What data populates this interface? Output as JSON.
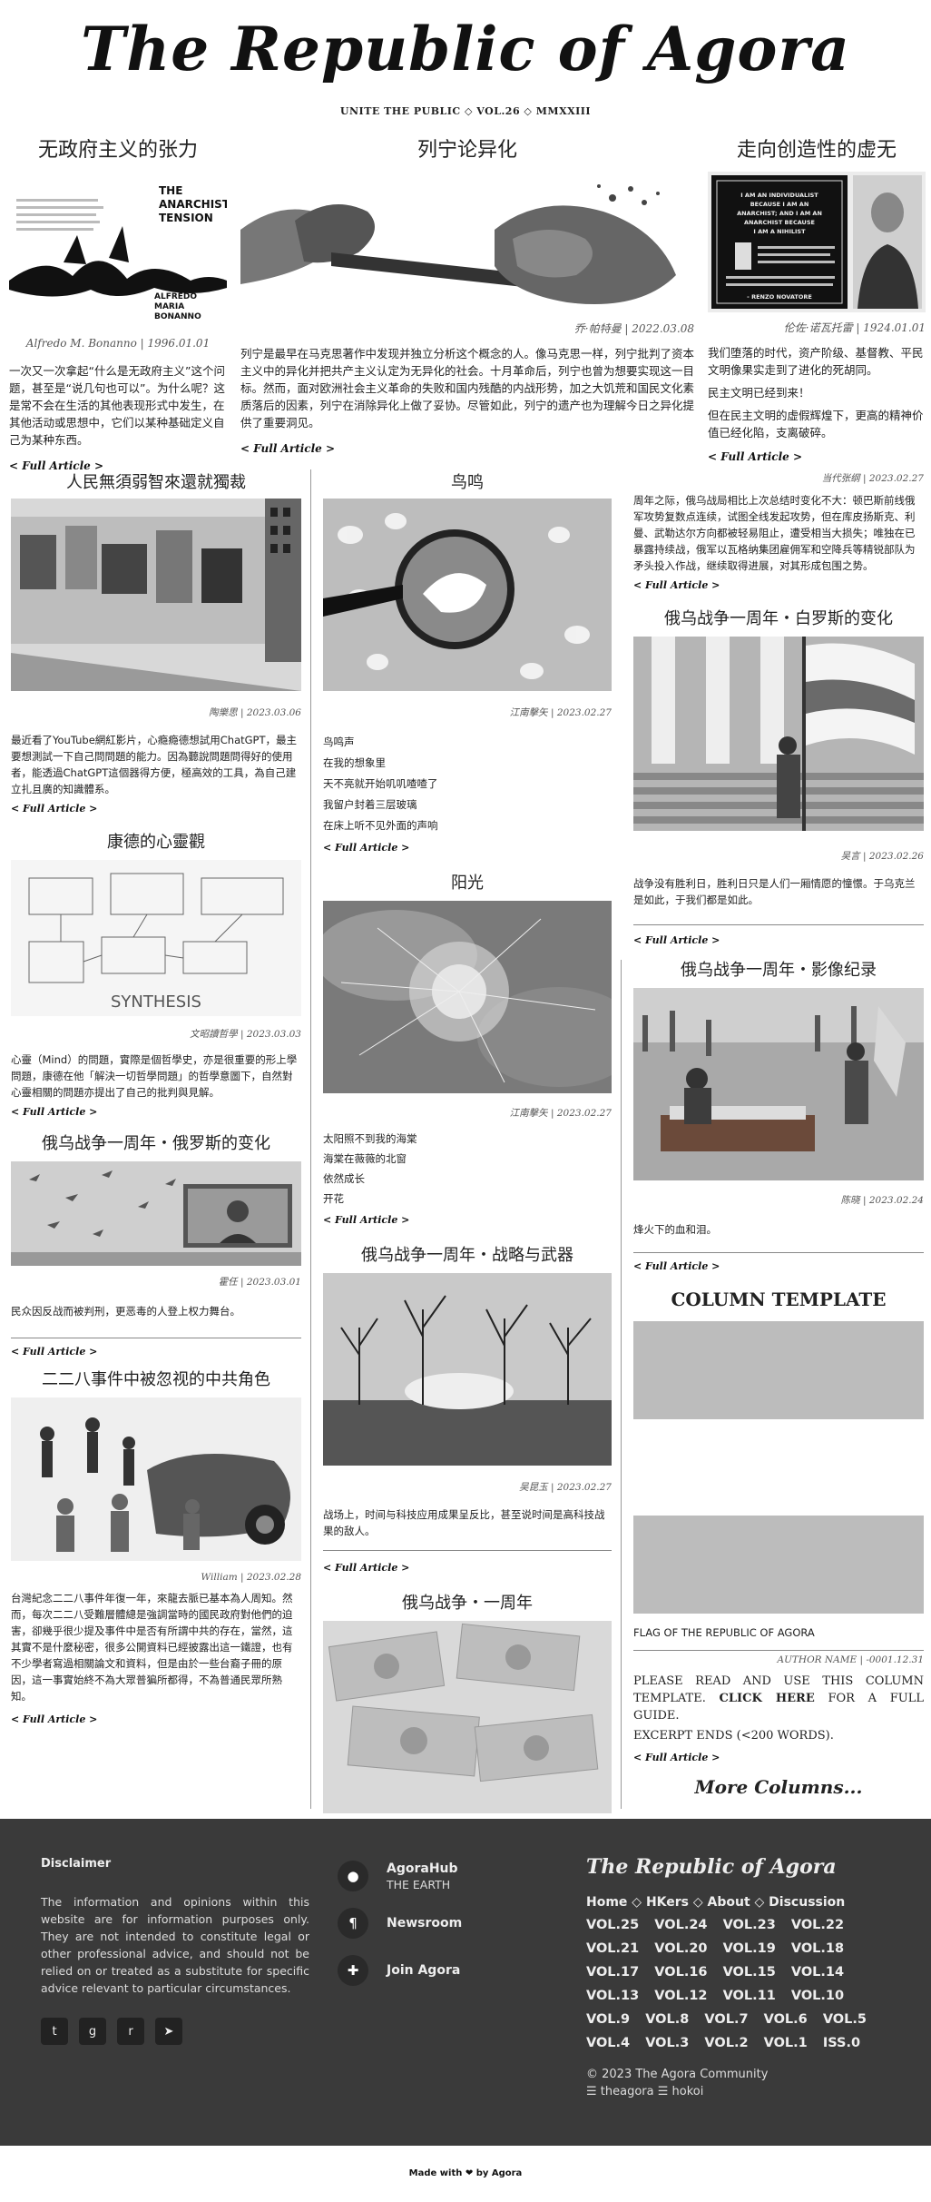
{
  "masthead": {
    "title": "The Republic of Agora",
    "tagline": "UNITE THE PUBLIC ◇ VOL.26 ◇ MMXXIII"
  },
  "top_articles": [
    {
      "title": "无政府主义的张力",
      "image_caption": "THE ANARCHIST TENSION",
      "image_author": "ALFREDO MARIA BONANNO",
      "meta": "Alfredo M. Bonanno | 1996.01.01",
      "body": "一次又一次拿起“什么是无政府主义”这个问题，甚至是“说几句也可以”。为什么呢？这是常不会在生活的其他表现形式中发生，在其他活动或思想中，它们以某种基础定义自己为某种东西。",
      "link": "< Full Article >"
    },
    {
      "title": "列宁论异化",
      "meta": "乔·帕特曼 | 2022.03.08",
      "body": "列宁是最早在马克思著作中发现并独立分析这个概念的人。像马克思一样，列宁批判了资本主义中的异化并把共产主义认定为无异化的社会。十月革命后，列宁也曾为想要实现这一目标。然而，面对欧洲社会主义革命的失败和国内残酷的内战形势，加之大饥荒和国民文化素质落后的因素，列宁在消除异化上做了妥协。尽管如此，列宁的遗产也为理解今日之异化提供了重要洞见。",
      "link": "< Full Article >"
    },
    {
      "title": "走向创造性的虚无",
      "image_caption": "I AM AN INDIVIDUALIST BECAUSE I AM AN ANARCHIST; AND I AM AN ANARCHIST BECAUSE I AM A NIHILIST",
      "image_author": "- RENZO NOVATORE",
      "meta": "伦佐·诺瓦托雷 | 1924.01.01",
      "body1": "我们堕落的时代，资产阶级、基督教、平民文明像果实走到了进化的死胡同。",
      "body2": "民主文明已经到来！",
      "body3": "但在民主文明的虚假辉煌下，更高的精神价值已经化陷，支离破碎。",
      "link": "< Full Article >"
    }
  ],
  "col1": [
    {
      "title": "人民無須弱智來還就獨裁",
      "meta": "陶樂思 | 2023.03.06",
      "body": "最近看了YouTube網紅影片，心瘾瘾德想試用ChatGPT，最主要想測試一下自己問問題的能力。因為聽說問題問得好的使用者，能透過ChatGPT這個器得方便，極高效的工具，為自己建立扎且廣的知識體系。",
      "link": "< Full Article >"
    },
    {
      "title": "康德的心靈觀",
      "image_label": "SYNTHESIS",
      "meta": "文昭讀哲學 | 2023.03.03",
      "body": "心靈（Mind）的問題，實際是個哲學史，亦是很重要的形上學問題，康德在他「解決一切哲學問題」的哲學意圖下，自然對心靈相關的問題亦提出了自己的批判與見解。",
      "link": "< Full Article >"
    },
    {
      "title": "俄乌战争一周年・俄罗斯的变化",
      "meta": "霍任 | 2023.03.01",
      "body": "民众因反战而被判刑，更恶毒的人登上权力舞台。",
      "link": "< Full Article >"
    },
    {
      "title": "二二八事件中被忽视的中共角色",
      "meta": "William | 2023.02.28",
      "body": "台灣紀念二二八事件年復一年，來龍去脈已基本為人周知。然而，每次二二八受難層體總是強調當時的國民政府對他們的迫害，卻幾乎很少提及事件中是否有所謂中共的存在，當然，這其實不是什麼秘密，很多公開資料已經披露出這一鐵證，也有不少學者寫過相關論文和資料，但是由於一些台裔子冊的原因，這一事實始終不為大眾普猵所都得，不為普通民眾所熟知。",
      "link": "< Full Article >"
    }
  ],
  "col2": [
    {
      "title": "鸟鸣",
      "meta": "江南擊矢 | 2023.02.27",
      "lines": [
        "鸟鸣声",
        "在我的想象里",
        "天不亮就开始叽叽喳喳了",
        "我留户封着三层玻璃",
        "在床上听不见外面的声响"
      ],
      "link": "< Full Article >"
    },
    {
      "title": "阳光",
      "meta": "江南擊矢 | 2023.02.27",
      "lines": [
        "太阳照不到我的海棠",
        "海棠在薇薇的北窗",
        "依然成长",
        "开花"
      ],
      "link": "< Full Article >"
    },
    {
      "title": "俄乌战争一周年・战略与武器",
      "meta": "吴昆玉 | 2023.02.27",
      "body": "战场上，时间与科技应用成果呈反比，甚至说时间是高科技战果的敌人。",
      "link": "< Full Article >"
    },
    {
      "title": "俄乌战争・一周年"
    }
  ],
  "col3": [
    {
      "meta": "当代张纲 | 2023.02.27",
      "body": "周年之际，俄乌战局相比上次总结时变化不大：顿巴斯前线俄军攻势复数点连续，试图全线发起攻势，但在库皮扬斯克、利曼、武勒达尔方向都被轻易阻止，遭受相当大损失；唯独在已暴露持续战，俄军以瓦格纳集团雇佣军和空降兵等精锐部队为矛头投入作战，继续取得进展，对其形成包围之势。",
      "link": "< Full Article >"
    },
    {
      "title": "俄乌战争一周年・白罗斯的变化",
      "meta": "吴言 | 2023.02.26",
      "body": "战争没有胜利日，胜利日只是人们一厢情愿的憧憬。于乌克兰是如此，于我们都是如此。",
      "link": "< Full Article >"
    },
    {
      "title": "俄乌战争一周年・影像纪录",
      "meta": "陈晓 | 2023.02.24",
      "body": "烽火下的血和泪。",
      "link": "< Full Article >"
    },
    {
      "title": "COLUMN TEMPLATE",
      "flag_caption": "FLAG OF THE REPUBLIC OF AGORA",
      "meta": "AUTHOR NAME | -0001.12.31",
      "body_pre": "PLEASE READ AND USE THIS COLUMN TEMPLATE.",
      "body_link": "CLICK HERE",
      "body_post": "FOR A FULL GUIDE.",
      "body2": "EXCERPT ENDS (<200 WORDS).",
      "link": "< Full Article >"
    },
    {
      "more": "More Columns..."
    }
  ],
  "footer": {
    "disclaimer_title": "Disclaimer",
    "disclaimer_text": "The information and opinions within this website are for information purposes only. They are not intended to constitute legal or other professional advice, and should not be relied on or treated as a substitute for specific advice relevant to particular circumstances.",
    "social": [
      "twitter-icon",
      "github-icon",
      "reddit-icon",
      "telegram-icon"
    ],
    "links": [
      {
        "label": "AgoraHub",
        "sub": "THE EARTH",
        "icon": "location-icon"
      },
      {
        "label": "Newsroom",
        "sub": "",
        "icon": "pilcrow-icon"
      },
      {
        "label": "Join Agora",
        "sub": "",
        "icon": "puzzle-icon"
      }
    ],
    "brand": "The Republic of Agora",
    "nav": [
      "Home",
      "HKers",
      "About",
      "Discussion"
    ],
    "vols": [
      "VOL.25",
      "VOL.24",
      "VOL.23",
      "VOL.22",
      "VOL.21",
      "VOL.20",
      "VOL.19",
      "VOL.18",
      "VOL.17",
      "VOL.16",
      "VOL.15",
      "VOL.14",
      "VOL.13",
      "VOL.12",
      "VOL.11",
      "VOL.10",
      "VOL.9",
      "VOL.8",
      "VOL.7",
      "VOL.6",
      "VOL.5",
      "VOL.4",
      "VOL.3",
      "VOL.2",
      "VOL.1",
      "ISS.0"
    ],
    "copyright": "© 2023 The Agora Community",
    "handles": "☰ theagora ☰ hokoi",
    "made_with": "Made with ❤ by Agora"
  }
}
